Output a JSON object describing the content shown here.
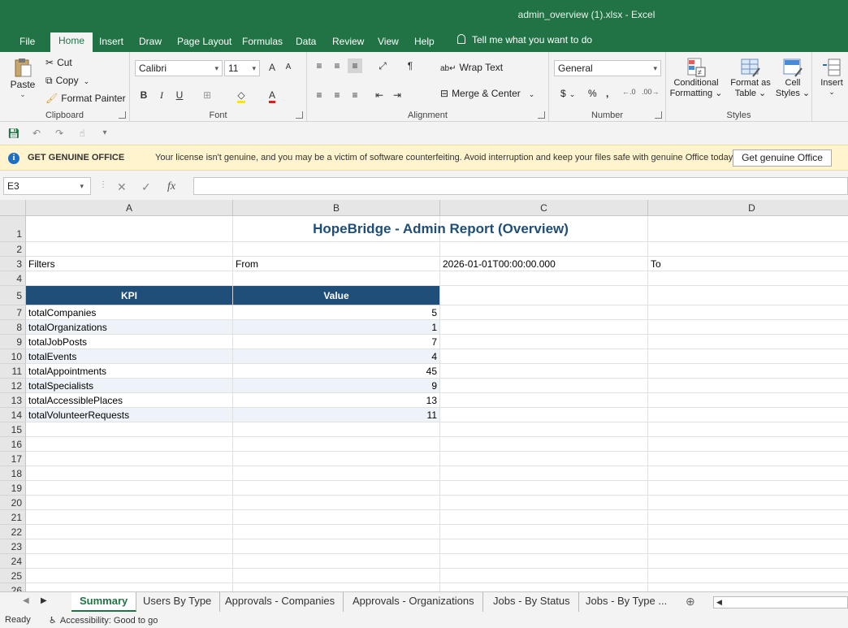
{
  "window": {
    "title": "admin_overview (1).xlsx  -  Excel"
  },
  "ribbon_tabs": [
    "File",
    "Home",
    "Insert",
    "Draw",
    "Page Layout",
    "Formulas",
    "Data",
    "Review",
    "View",
    "Help"
  ],
  "tell_me": "Tell me what you want to do",
  "clipboard": {
    "paste": "Paste",
    "cut": "Cut",
    "copy": "Copy",
    "format_painter": "Format Painter",
    "label": "Clipboard"
  },
  "font": {
    "name": "Calibri",
    "size": "11",
    "label": "Font",
    "bold": "B",
    "italic": "I",
    "underline": "U",
    "grow": "A",
    "shrink": "A"
  },
  "alignment": {
    "wrap": "Wrap Text",
    "merge": "Merge & Center",
    "label": "Alignment"
  },
  "number": {
    "format": "General",
    "label": "Number",
    "currency": "$",
    "percent": "%",
    "comma": ","
  },
  "styles": {
    "conditional_1": "Conditional",
    "conditional_2": "Formatting",
    "format_table_1": "Format as",
    "format_table_2": "Table",
    "cell_styles_1": "Cell",
    "cell_styles_2": "Styles",
    "label": "Styles"
  },
  "cells": {
    "insert": "Insert"
  },
  "message_bar": {
    "heading": "GET GENUINE OFFICE",
    "text": "Your license isn't genuine, and you may be a victim of software counterfeiting. Avoid interruption and keep your files safe with genuine Office today.",
    "button": "Get genuine Office"
  },
  "formula_bar": {
    "name_box": "E3",
    "fx": "fx",
    "formula": ""
  },
  "columns": [
    "A",
    "B",
    "C",
    "D"
  ],
  "rows": [
    "1",
    "2",
    "3",
    "4",
    "5",
    "7",
    "8",
    "9",
    "10",
    "11",
    "12",
    "13",
    "14",
    "15",
    "16",
    "17",
    "18",
    "19",
    "20",
    "21",
    "22",
    "23",
    "24",
    "25",
    "26"
  ],
  "sheet": {
    "title": "HopeBridge - Admin Report (Overview)",
    "filters_label": "Filters",
    "from_label": "From",
    "from_value": "2026-01-01T00:00:00.000",
    "to_label": "To",
    "table_headers": [
      "KPI",
      "Value"
    ],
    "kpis": [
      {
        "name": "totalCompanies",
        "value": "5"
      },
      {
        "name": "totalOrganizations",
        "value": "1"
      },
      {
        "name": "totalJobPosts",
        "value": "7"
      },
      {
        "name": "totalEvents",
        "value": "4"
      },
      {
        "name": "totalAppointments",
        "value": "45"
      },
      {
        "name": "totalSpecialists",
        "value": "9"
      },
      {
        "name": "totalAccessiblePlaces",
        "value": "13"
      },
      {
        "name": "totalVolunteerRequests",
        "value": "11"
      }
    ]
  },
  "sheet_tabs": [
    "Summary",
    "Users By Type",
    "Approvals - Companies",
    "Approvals - Organizations",
    "Jobs - By Status",
    "Jobs - By Type ..."
  ],
  "status": {
    "ready": "Ready",
    "accessibility": "Accessibility: Good to go"
  },
  "colors": {
    "excel_green": "#217346",
    "header_blue": "#1f4e79",
    "message_yellow": "#fff4ce"
  }
}
